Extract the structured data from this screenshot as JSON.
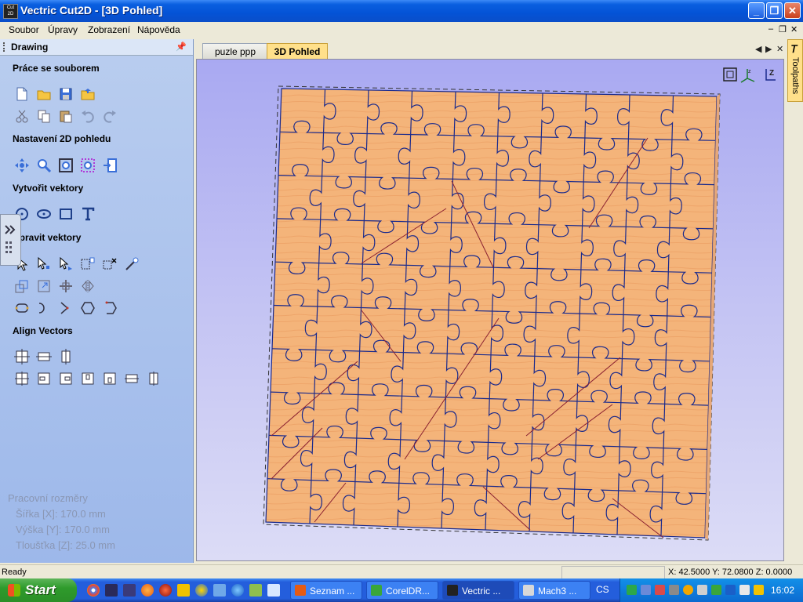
{
  "window": {
    "title": "Vectric Cut2D - [3D Pohled]",
    "app_icon_text": "Cut 2D"
  },
  "menu": {
    "items": [
      "Soubor",
      "Úpravy",
      "Zobrazení",
      "Nápověda"
    ]
  },
  "panel": {
    "title": "Drawing",
    "sections": {
      "file": "Práce se souborem",
      "view2d": "Nastavení 2D pohledu",
      "create": "Vytvořit vektory",
      "edit": "Upravit vektory",
      "align": "Align Vectors"
    },
    "dimensions": {
      "heading": "Pracovní rozměry",
      "width": "Šířka    [X]: 170.0 mm",
      "height": "Výška    [Y]: 170.0 mm",
      "thickness": "Tloušťka [Z]: 25.0 mm"
    }
  },
  "tabs": [
    {
      "label": "puzle   ppp",
      "active": false
    },
    {
      "label": "3D Pohled",
      "active": true
    }
  ],
  "toolpaths_tab": {
    "label": "Toolpaths"
  },
  "status": {
    "ready": "Ready",
    "coords": "X: 42.5000 Y: 72.0800 Z:  0.0000"
  },
  "taskbar": {
    "start": "Start",
    "items": [
      {
        "label": "Seznam ...",
        "active": false
      },
      {
        "label": "CorelDR...",
        "active": false
      },
      {
        "label": "Vectric ...",
        "active": true
      },
      {
        "label": "Mach3 ...",
        "active": false
      }
    ],
    "language": "CS",
    "clock": "16:02"
  },
  "colors": {
    "wood": "#f4b47a",
    "cut_lines": "#1a2a8c",
    "tab_active": "#ffe08a",
    "titlebar": "#0453d6"
  }
}
